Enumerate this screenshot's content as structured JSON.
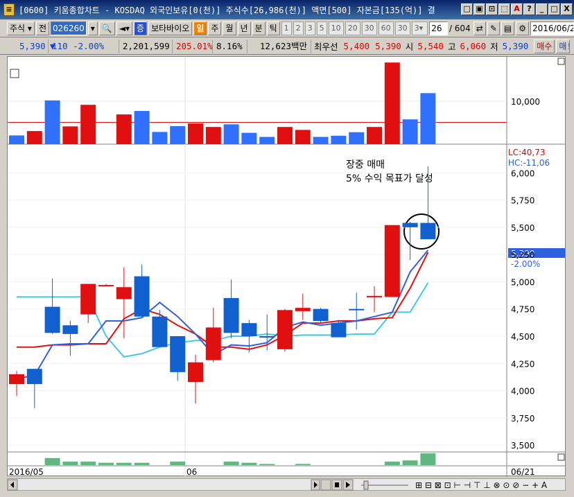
{
  "window": {
    "title": "[0600] 키움종합차트 - KOSDAQ 외국인보유[0(천)] 주식수[26,986(천)] 액면[500] 자본금[135(억)] 결",
    "app_icon": "chart-app-icon",
    "controls": [
      "□",
      "▣",
      "⊡",
      "⬚",
      "A",
      "?",
      "_",
      "□",
      "X"
    ]
  },
  "toolbar": {
    "type_label": "주식",
    "all_label": "전",
    "code_value": "026260",
    "stock_badge": "증",
    "stock_name": "보타바이오",
    "period_active": "일",
    "periods": [
      "주",
      "월",
      "년",
      "분",
      "틱"
    ],
    "minute_options": [
      "1",
      "2",
      "3",
      "5",
      "10",
      "20",
      "30",
      "60",
      "30",
      "3"
    ],
    "count_value": "26",
    "count_total": "/ 604",
    "date_value": "2016/06/2"
  },
  "quote": {
    "price": "5,390",
    "direction": "▼",
    "change": "110",
    "change_pct": "-2.00%",
    "volume": "2,201,599",
    "volume_ratio": "205.01%",
    "turnover": "8.16%",
    "amount": "12,623백만",
    "best_label": "최우선",
    "best_ask": "5,400",
    "best_bid": "5,390",
    "open_label": "시",
    "open": "5,540",
    "high_label": "고",
    "high": "6,060",
    "low_label": "저",
    "low": "5,390",
    "buy_button": "매수",
    "sell_button": "매!"
  },
  "price_labels": [
    "6,000",
    "5,750",
    "5,500",
    "5,250",
    "5,000",
    "4,750",
    "4,500",
    "4,250",
    "4,000",
    "3,750",
    "3,500"
  ],
  "volume_label": "10,000",
  "limit_up": "LC:40,73",
  "limit_hc": "HC:-11,06",
  "current_price_tag": "5,390",
  "current_pct_tag": "-2.00%",
  "annotation": {
    "line1": "장중 매매",
    "line2": "5% 수익 목표가 달성"
  },
  "x_labels": {
    "start": "2016/05",
    "mid": "06",
    "end": "06/21"
  },
  "colors": {
    "up": "#e01010",
    "down": "#1060d0",
    "ma5": "#3060e0",
    "ma10": "#e01010",
    "ma20": "#40c8e0",
    "vol_down": "#3070ff"
  },
  "chart_data": {
    "type": "candlestick",
    "ylim": [
      3450,
      6250
    ],
    "candles": [
      {
        "o": 4060,
        "h": 4180,
        "l": 3950,
        "c": 4150
      },
      {
        "o": 4200,
        "h": 4200,
        "l": 3840,
        "c": 4060
      },
      {
        "o": 4770,
        "h": 5030,
        "l": 4520,
        "c": 4530
      },
      {
        "o": 4600,
        "h": 4640,
        "l": 4320,
        "c": 4520
      },
      {
        "o": 4700,
        "h": 4980,
        "l": 4620,
        "c": 4980
      },
      {
        "o": 4960,
        "h": 4980,
        "l": 4960,
        "c": 4970
      },
      {
        "o": 4840,
        "h": 5130,
        "l": 4480,
        "c": 4950
      },
      {
        "o": 5050,
        "h": 5160,
        "l": 4690,
        "c": 4680
      },
      {
        "o": 4680,
        "h": 4740,
        "l": 4440,
        "c": 4400
      },
      {
        "o": 4500,
        "h": 4500,
        "l": 4090,
        "c": 4170
      },
      {
        "o": 4080,
        "h": 4330,
        "l": 3880,
        "c": 4260
      },
      {
        "o": 4280,
        "h": 4760,
        "l": 4260,
        "c": 4580
      },
      {
        "o": 4850,
        "h": 5020,
        "l": 4480,
        "c": 4530
      },
      {
        "o": 4620,
        "h": 4650,
        "l": 4350,
        "c": 4500
      },
      {
        "o": 4500,
        "h": 4700,
        "l": 4370,
        "c": 4490
      },
      {
        "o": 4380,
        "h": 4750,
        "l": 4360,
        "c": 4740
      },
      {
        "o": 4730,
        "h": 4890,
        "l": 4650,
        "c": 4760
      },
      {
        "o": 4750,
        "h": 4760,
        "l": 4630,
        "c": 4640
      },
      {
        "o": 4620,
        "h": 4650,
        "l": 4490,
        "c": 4490
      },
      {
        "o": 4750,
        "h": 4900,
        "l": 4560,
        "c": 4740
      },
      {
        "o": 4860,
        "h": 4960,
        "l": 4720,
        "c": 4870
      },
      {
        "o": 4860,
        "h": 5520,
        "l": 4860,
        "c": 5520
      },
      {
        "o": 5540,
        "h": 5550,
        "l": 5200,
        "c": 5500
      },
      {
        "o": 5540,
        "h": 6060,
        "l": 5390,
        "c": 5390
      }
    ],
    "ma5": [
      4110,
      4140,
      4420,
      4430,
      4430,
      4640,
      4640,
      4670,
      4810,
      4680,
      4520,
      4330,
      4420,
      4410,
      4440,
      4580,
      4630,
      4600,
      4620,
      4640,
      4680,
      4720,
      5090,
      5290
    ],
    "ma10": [
      4400,
      4400,
      4420,
      4420,
      4430,
      4430,
      4660,
      4750,
      4700,
      4600,
      4520,
      4400,
      4400,
      4380,
      4420,
      4510,
      4620,
      4620,
      4640,
      4640,
      4660,
      4670,
      4940,
      5270
    ],
    "ma20": [
      4860,
      4860,
      4860,
      4860,
      4860,
      4500,
      4310,
      4340,
      4400,
      4440,
      4460,
      4460,
      4500,
      4500,
      4520,
      4500,
      4510,
      4510,
      4510,
      4520,
      4520,
      4720,
      4720,
      4990
    ],
    "volume": [
      {
        "v": 3000,
        "d": "down"
      },
      {
        "v": 4500,
        "d": "up"
      },
      {
        "v": 15000,
        "d": "down"
      },
      {
        "v": 6100,
        "d": "up"
      },
      {
        "v": 13500,
        "d": "up"
      },
      {
        "v": 0,
        "d": "up"
      },
      {
        "v": 10200,
        "d": "up"
      },
      {
        "v": 11400,
        "d": "down"
      },
      {
        "v": 4200,
        "d": "down"
      },
      {
        "v": 6200,
        "d": "down"
      },
      {
        "v": 7100,
        "d": "up"
      },
      {
        "v": 5900,
        "d": "up"
      },
      {
        "v": 6800,
        "d": "down"
      },
      {
        "v": 3900,
        "d": "down"
      },
      {
        "v": 2500,
        "d": "down"
      },
      {
        "v": 5900,
        "d": "up"
      },
      {
        "v": 4900,
        "d": "up"
      },
      {
        "v": 2500,
        "d": "down"
      },
      {
        "v": 2900,
        "d": "down"
      },
      {
        "v": 4100,
        "d": "down"
      },
      {
        "v": 5900,
        "d": "up"
      },
      {
        "v": 28000,
        "d": "up"
      },
      {
        "v": 8500,
        "d": "down"
      },
      {
        "v": 17500,
        "d": "down"
      }
    ],
    "vol_ylim": [
      0,
      29000
    ],
    "vol_avg": 7500,
    "small_volume": [
      0,
      0,
      6,
      3,
      3,
      2,
      2,
      2,
      0,
      3,
      0,
      0,
      3,
      2,
      1,
      0,
      1,
      0,
      0,
      0,
      0,
      3,
      4,
      10
    ]
  }
}
